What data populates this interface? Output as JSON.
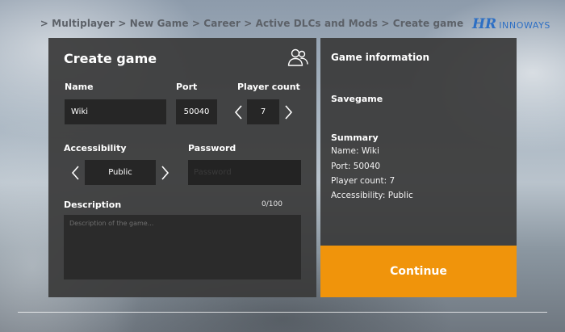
{
  "breadcrumb": "> Multiplayer > New Game > Career > Active DLCs and Mods > Create game",
  "logo": {
    "mark": "HR",
    "text": "INNOWAYS",
    "color": "#2d6fc4"
  },
  "create": {
    "title": "Create game",
    "icon": "users-icon",
    "name_label": "Name",
    "name_value": "Wiki",
    "port_label": "Port",
    "port_value": "50040",
    "player_count_label": "Player count",
    "player_count_value": "7",
    "accessibility_label": "Accessibility",
    "accessibility_value": "Public",
    "password_label": "Password",
    "password_placeholder": "Password",
    "description_label": "Description",
    "description_counter": "0/100",
    "description_placeholder": "Description of the game..."
  },
  "info": {
    "title": "Game information",
    "savegame_label": "Savegame",
    "summary_title": "Summary",
    "summary_lines": [
      "Name: Wiki",
      "Port: 50040",
      "Player count: 7",
      "Accessibility: Public"
    ]
  },
  "continue_label": "Continue",
  "colors": {
    "accent": "#f0940b",
    "panel": "#3a3a3a",
    "field": "#262626"
  }
}
